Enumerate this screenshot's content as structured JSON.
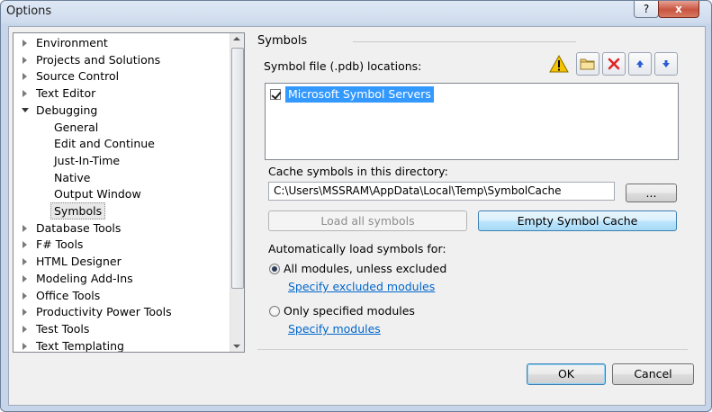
{
  "window": {
    "title": "Options",
    "help_glyph": "?",
    "close_glyph": "x"
  },
  "tree": {
    "items": [
      {
        "label": "Environment",
        "expanded": false
      },
      {
        "label": "Projects and Solutions",
        "expanded": false
      },
      {
        "label": "Source Control",
        "expanded": false
      },
      {
        "label": "Text Editor",
        "expanded": false
      },
      {
        "label": "Debugging",
        "expanded": true
      },
      {
        "label": "General",
        "child": true
      },
      {
        "label": "Edit and Continue",
        "child": true
      },
      {
        "label": "Just-In-Time",
        "child": true
      },
      {
        "label": "Native",
        "child": true
      },
      {
        "label": "Output Window",
        "child": true
      },
      {
        "label": "Symbols",
        "child": true,
        "selected": true
      },
      {
        "label": "Database Tools",
        "expanded": false
      },
      {
        "label": "F# Tools",
        "expanded": false
      },
      {
        "label": "HTML Designer",
        "expanded": false
      },
      {
        "label": "Modeling Add-Ins",
        "expanded": false
      },
      {
        "label": "Office Tools",
        "expanded": false
      },
      {
        "label": "Productivity Power Tools",
        "expanded": false
      },
      {
        "label": "Test Tools",
        "expanded": false
      },
      {
        "label": "Text Templating",
        "expanded": false
      }
    ]
  },
  "symbols": {
    "section_title": "Symbols",
    "locations_label": "Symbol file (.pdb) locations:",
    "toolbar_icons": [
      "warning-icon",
      "folder-icon",
      "delete-icon",
      "move-up-icon",
      "move-down-icon"
    ],
    "locations": [
      {
        "label": "Microsoft Symbol Servers",
        "checked": true
      }
    ],
    "cache_label": "Cache symbols in this directory:",
    "cache_path": "C:\\Users\\MSSRAM\\AppData\\Local\\Temp\\SymbolCache",
    "browse_label": "...",
    "load_all_label": "Load all symbols",
    "empty_cache_label": "Empty Symbol Cache",
    "auto_load_label": "Automatically load symbols for:",
    "option_all_label": "All modules, unless excluded",
    "link_excluded": "Specify excluded modules",
    "option_specified_label": "Only specified modules",
    "link_specified": "Specify modules",
    "selected_option": "all"
  },
  "buttons": {
    "ok": "OK",
    "cancel": "Cancel"
  },
  "colors": {
    "selection": "#3399ff",
    "link": "#0066cc",
    "focus_border": "#3c7fb1",
    "delete_red": "#e02424",
    "arrow_blue": "#2a5bd7",
    "warning_yellow": "#f5c400"
  }
}
